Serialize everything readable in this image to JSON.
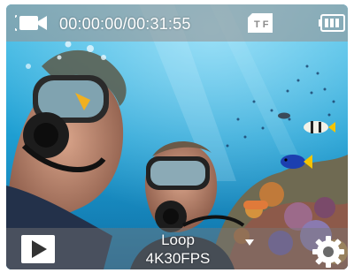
{
  "status_bar": {
    "mode_icon": "video-camera-icon",
    "timer": "00:00:00/00:31:55",
    "storage_icon": "sd-card-icon",
    "storage_label": "T F",
    "battery_icon": "battery-icon",
    "battery_level": 1.0
  },
  "bottom_bar": {
    "play_icon": "play-icon",
    "mode_name": "Loop",
    "resolution": "4K30FPS",
    "mode_dropdown_icon": "caret-down-icon",
    "settings_icon": "gear-icon"
  },
  "colors": {
    "overlay_bar": "#969696",
    "icon_white": "#ffffff",
    "water": "#1f9fd0"
  }
}
